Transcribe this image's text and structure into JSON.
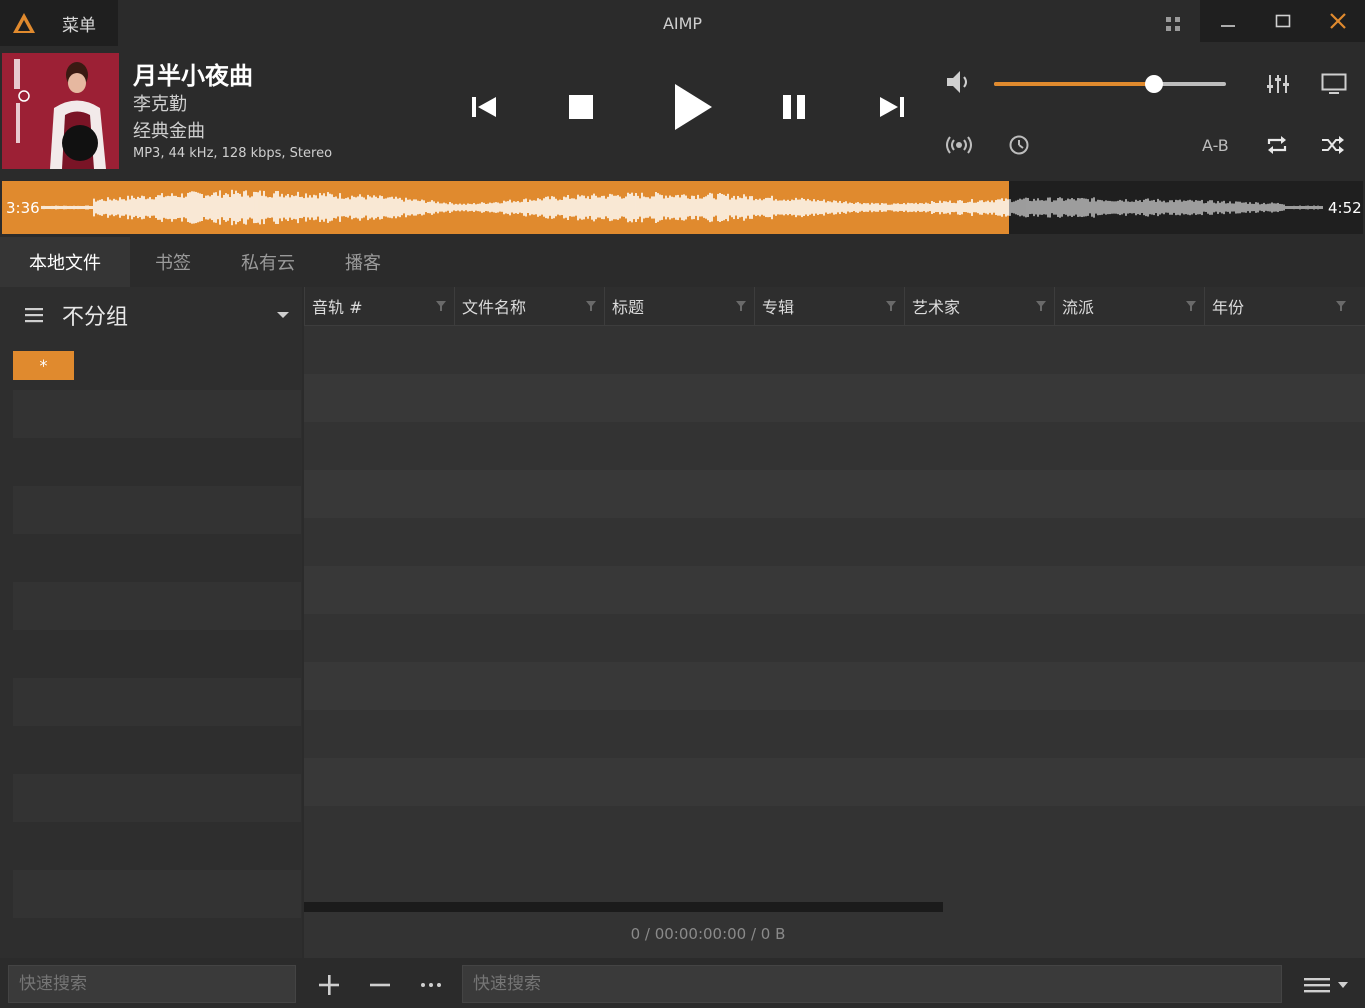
{
  "titlebar": {
    "menu_label": "菜单",
    "app_title": "AIMP"
  },
  "track": {
    "title": "月半小夜曲",
    "artist": "李克勤",
    "album": "经典金曲",
    "info": "MP3, 44 kHz, 128 kbps, Stereo"
  },
  "playback": {
    "elapsed": "3:36",
    "total": "4:52",
    "progress_fraction": 0.74,
    "volume_fraction": 0.69,
    "ab_label": "A-B"
  },
  "tabs": [
    {
      "label": "本地文件",
      "active": true
    },
    {
      "label": "书签",
      "active": false
    },
    {
      "label": "私有云",
      "active": false
    },
    {
      "label": "播客",
      "active": false
    }
  ],
  "left_pane": {
    "group_label": "不分组",
    "star_item": "*",
    "search_placeholder": "快速搜索"
  },
  "table": {
    "columns": [
      "音轨 #",
      "文件名称",
      "标题",
      "专辑",
      "艺术家",
      "流派",
      "年份"
    ],
    "summary": "0 / 00:00:00:00 / 0 B"
  },
  "bottom": {
    "search_placeholder": "快速搜索"
  },
  "colors": {
    "accent": "#e08a2e",
    "background": "#2b2b2b"
  }
}
